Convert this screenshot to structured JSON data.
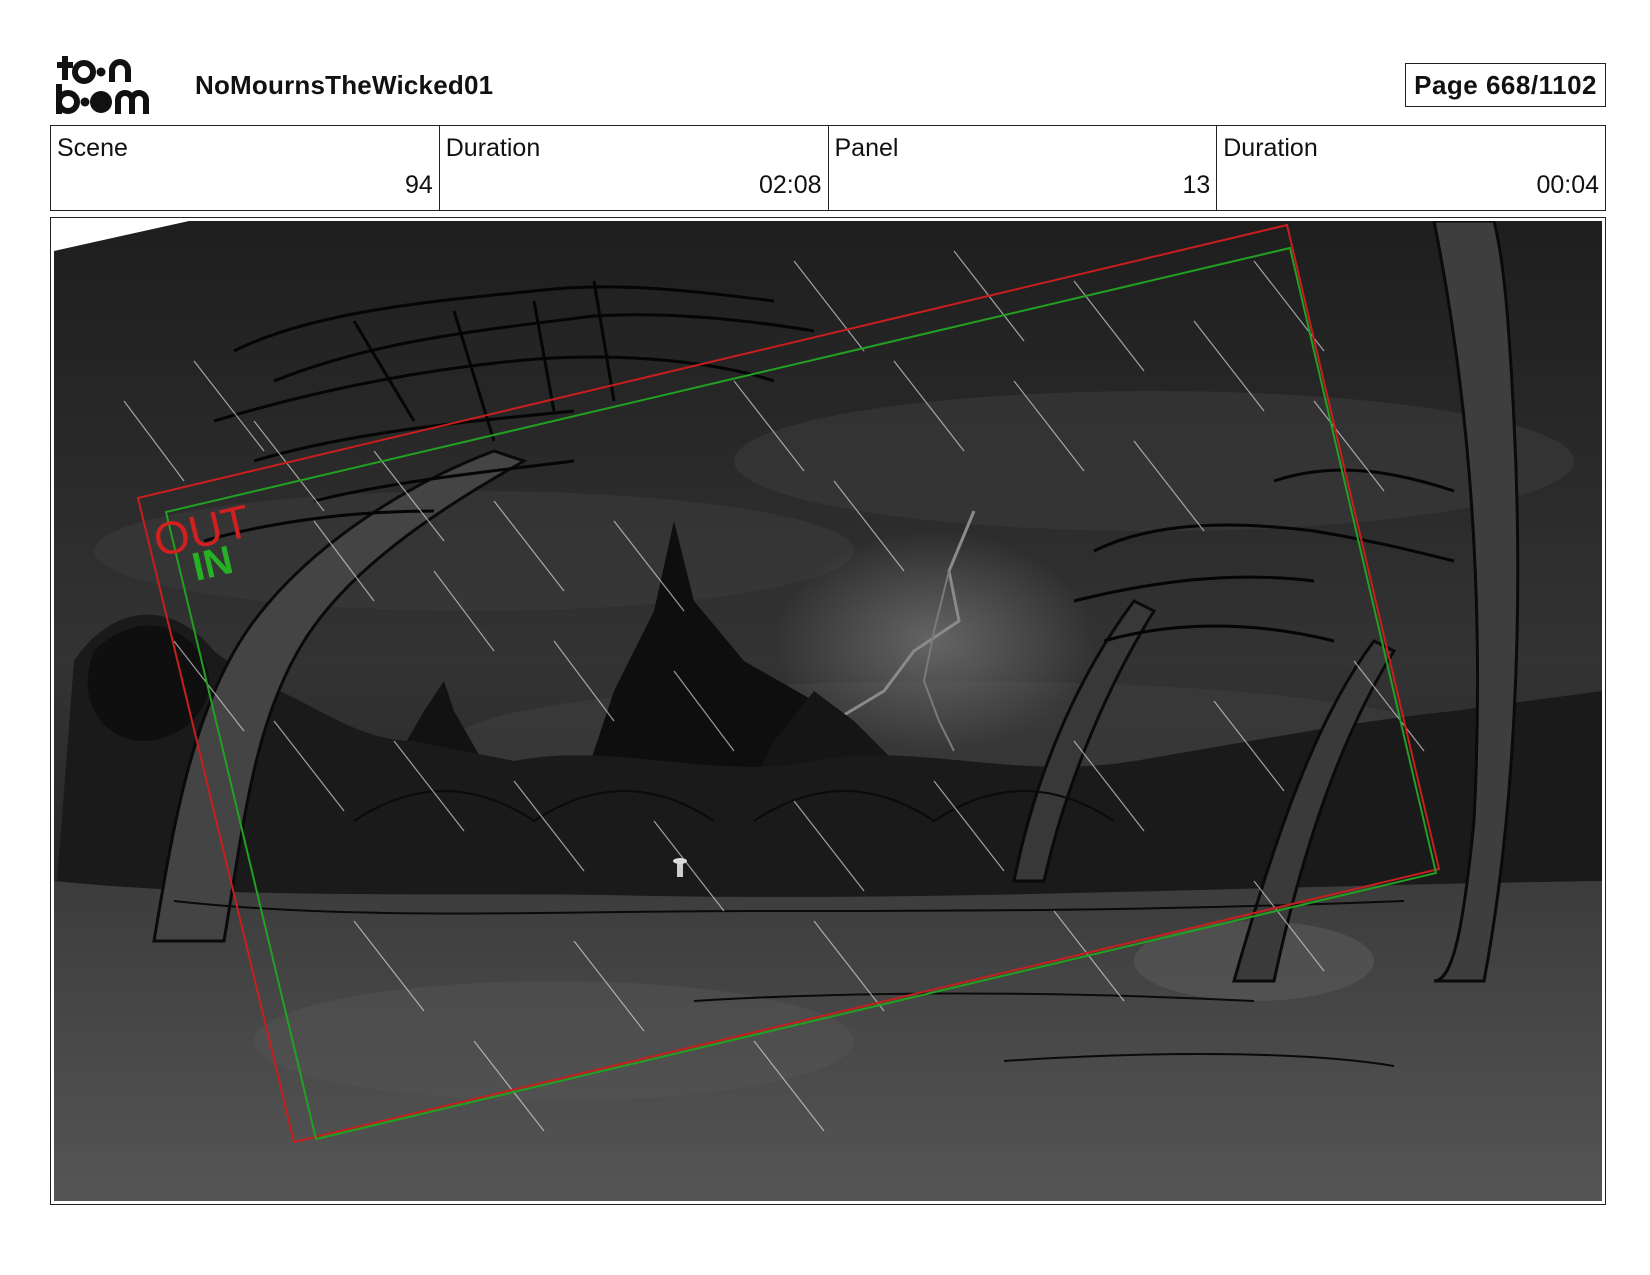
{
  "header": {
    "project_title": "NoMournsTheWicked01",
    "page_indicator": "Page  668/1102",
    "logo_icon": "toon-boom-logo"
  },
  "info": {
    "scene": {
      "label": "Scene",
      "value": "94"
    },
    "scene_duration": {
      "label": "Duration",
      "value": "02:08"
    },
    "panel": {
      "label": "Panel",
      "value": "13"
    },
    "panel_duration": {
      "label": "Duration",
      "value": "00:04"
    }
  },
  "panel_image": {
    "description_icon": "storyboard-drawing",
    "camera_out_label": "OUT",
    "camera_in_label": "IN",
    "colors": {
      "camera_out": "#c81e1e",
      "camera_in": "#22a022",
      "sky": "#2c2c2c",
      "ground": "#4a4a4a"
    }
  }
}
